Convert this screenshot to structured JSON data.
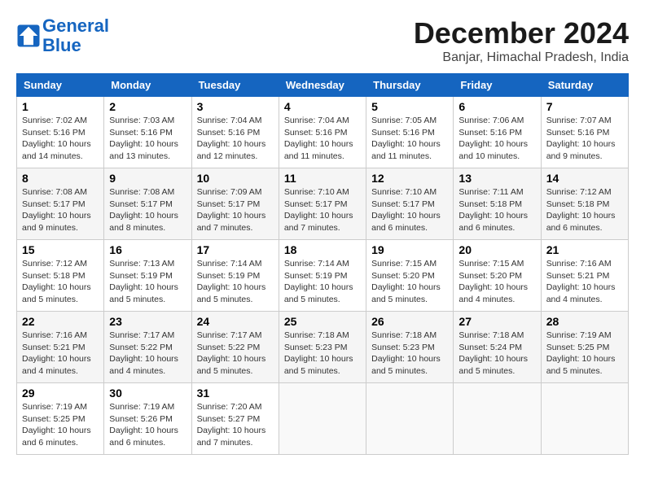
{
  "logo": {
    "line1": "General",
    "line2": "Blue"
  },
  "title": "December 2024",
  "location": "Banjar, Himachal Pradesh, India",
  "weekdays": [
    "Sunday",
    "Monday",
    "Tuesday",
    "Wednesday",
    "Thursday",
    "Friday",
    "Saturday"
  ],
  "weeks": [
    [
      {
        "day": "1",
        "info": "Sunrise: 7:02 AM\nSunset: 5:16 PM\nDaylight: 10 hours\nand 14 minutes."
      },
      {
        "day": "2",
        "info": "Sunrise: 7:03 AM\nSunset: 5:16 PM\nDaylight: 10 hours\nand 13 minutes."
      },
      {
        "day": "3",
        "info": "Sunrise: 7:04 AM\nSunset: 5:16 PM\nDaylight: 10 hours\nand 12 minutes."
      },
      {
        "day": "4",
        "info": "Sunrise: 7:04 AM\nSunset: 5:16 PM\nDaylight: 10 hours\nand 11 minutes."
      },
      {
        "day": "5",
        "info": "Sunrise: 7:05 AM\nSunset: 5:16 PM\nDaylight: 10 hours\nand 11 minutes."
      },
      {
        "day": "6",
        "info": "Sunrise: 7:06 AM\nSunset: 5:16 PM\nDaylight: 10 hours\nand 10 minutes."
      },
      {
        "day": "7",
        "info": "Sunrise: 7:07 AM\nSunset: 5:16 PM\nDaylight: 10 hours\nand 9 minutes."
      }
    ],
    [
      {
        "day": "8",
        "info": "Sunrise: 7:08 AM\nSunset: 5:17 PM\nDaylight: 10 hours\nand 9 minutes."
      },
      {
        "day": "9",
        "info": "Sunrise: 7:08 AM\nSunset: 5:17 PM\nDaylight: 10 hours\nand 8 minutes."
      },
      {
        "day": "10",
        "info": "Sunrise: 7:09 AM\nSunset: 5:17 PM\nDaylight: 10 hours\nand 7 minutes."
      },
      {
        "day": "11",
        "info": "Sunrise: 7:10 AM\nSunset: 5:17 PM\nDaylight: 10 hours\nand 7 minutes."
      },
      {
        "day": "12",
        "info": "Sunrise: 7:10 AM\nSunset: 5:17 PM\nDaylight: 10 hours\nand 6 minutes."
      },
      {
        "day": "13",
        "info": "Sunrise: 7:11 AM\nSunset: 5:18 PM\nDaylight: 10 hours\nand 6 minutes."
      },
      {
        "day": "14",
        "info": "Sunrise: 7:12 AM\nSunset: 5:18 PM\nDaylight: 10 hours\nand 6 minutes."
      }
    ],
    [
      {
        "day": "15",
        "info": "Sunrise: 7:12 AM\nSunset: 5:18 PM\nDaylight: 10 hours\nand 5 minutes."
      },
      {
        "day": "16",
        "info": "Sunrise: 7:13 AM\nSunset: 5:19 PM\nDaylight: 10 hours\nand 5 minutes."
      },
      {
        "day": "17",
        "info": "Sunrise: 7:14 AM\nSunset: 5:19 PM\nDaylight: 10 hours\nand 5 minutes."
      },
      {
        "day": "18",
        "info": "Sunrise: 7:14 AM\nSunset: 5:19 PM\nDaylight: 10 hours\nand 5 minutes."
      },
      {
        "day": "19",
        "info": "Sunrise: 7:15 AM\nSunset: 5:20 PM\nDaylight: 10 hours\nand 5 minutes."
      },
      {
        "day": "20",
        "info": "Sunrise: 7:15 AM\nSunset: 5:20 PM\nDaylight: 10 hours\nand 4 minutes."
      },
      {
        "day": "21",
        "info": "Sunrise: 7:16 AM\nSunset: 5:21 PM\nDaylight: 10 hours\nand 4 minutes."
      }
    ],
    [
      {
        "day": "22",
        "info": "Sunrise: 7:16 AM\nSunset: 5:21 PM\nDaylight: 10 hours\nand 4 minutes."
      },
      {
        "day": "23",
        "info": "Sunrise: 7:17 AM\nSunset: 5:22 PM\nDaylight: 10 hours\nand 4 minutes."
      },
      {
        "day": "24",
        "info": "Sunrise: 7:17 AM\nSunset: 5:22 PM\nDaylight: 10 hours\nand 5 minutes."
      },
      {
        "day": "25",
        "info": "Sunrise: 7:18 AM\nSunset: 5:23 PM\nDaylight: 10 hours\nand 5 minutes."
      },
      {
        "day": "26",
        "info": "Sunrise: 7:18 AM\nSunset: 5:23 PM\nDaylight: 10 hours\nand 5 minutes."
      },
      {
        "day": "27",
        "info": "Sunrise: 7:18 AM\nSunset: 5:24 PM\nDaylight: 10 hours\nand 5 minutes."
      },
      {
        "day": "28",
        "info": "Sunrise: 7:19 AM\nSunset: 5:25 PM\nDaylight: 10 hours\nand 5 minutes."
      }
    ],
    [
      {
        "day": "29",
        "info": "Sunrise: 7:19 AM\nSunset: 5:25 PM\nDaylight: 10 hours\nand 6 minutes."
      },
      {
        "day": "30",
        "info": "Sunrise: 7:19 AM\nSunset: 5:26 PM\nDaylight: 10 hours\nand 6 minutes."
      },
      {
        "day": "31",
        "info": "Sunrise: 7:20 AM\nSunset: 5:27 PM\nDaylight: 10 hours\nand 7 minutes."
      },
      null,
      null,
      null,
      null
    ]
  ]
}
